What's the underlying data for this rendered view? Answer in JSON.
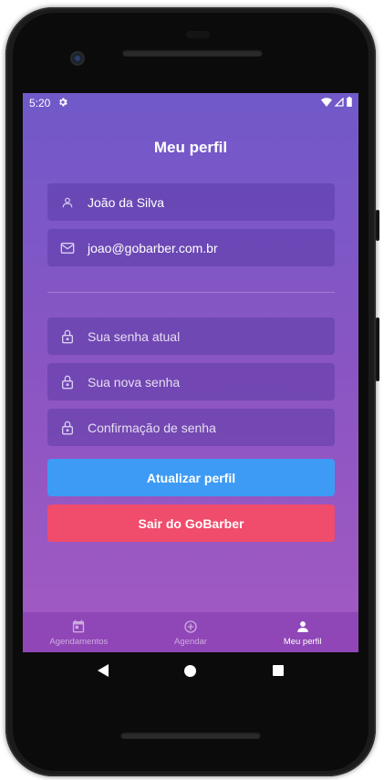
{
  "status_bar": {
    "time": "5:20",
    "icons": [
      "settings-gear-icon",
      "wifi-icon",
      "signal-icon",
      "battery-icon"
    ]
  },
  "page": {
    "title": "Meu perfil"
  },
  "profile_form": {
    "name": {
      "value": "João da Silva",
      "icon": "user-icon"
    },
    "email": {
      "value": "joao@gobarber.com.br",
      "icon": "mail-icon"
    },
    "current_password": {
      "placeholder": "Sua senha atual",
      "value": "",
      "icon": "lock-icon"
    },
    "new_password": {
      "placeholder": "Sua nova senha",
      "value": "",
      "icon": "lock-icon"
    },
    "confirm_password": {
      "placeholder": "Confirmação de senha",
      "value": "",
      "icon": "lock-icon"
    }
  },
  "actions": {
    "update_label": "Atualizar perfil",
    "logout_label": "Sair do GoBarber"
  },
  "tabs": [
    {
      "label": "Agendamentos",
      "icon": "calendar-icon",
      "active": false
    },
    {
      "label": "Agendar",
      "icon": "add-circle-icon",
      "active": false
    },
    {
      "label": "Meu perfil",
      "icon": "person-icon",
      "active": true
    }
  ],
  "colors": {
    "gradient_top": "#7159c9",
    "gradient_bottom": "#a35ac2",
    "update_button": "#3d9bf5",
    "logout_button": "#f04c6c"
  }
}
